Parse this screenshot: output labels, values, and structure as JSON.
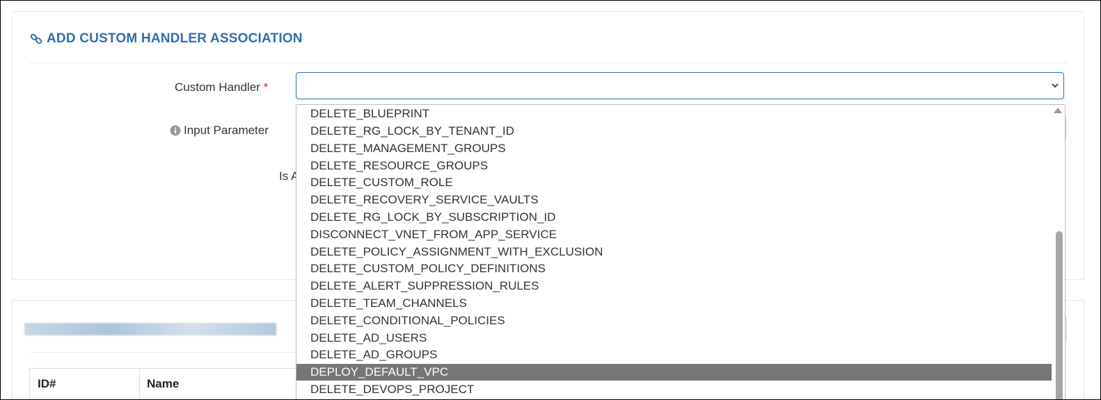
{
  "form": {
    "title": "ADD CUSTOM HANDLER ASSOCIATION",
    "custom_handler_label": "Custom Handler",
    "required_mark": "*",
    "input_parameter_label": "Input Parameter",
    "partial_label": "Is A",
    "custom_handler_value": ""
  },
  "dropdown": {
    "options": [
      "DELETE_BLUEPRINT",
      "DELETE_RG_LOCK_BY_TENANT_ID",
      "DELETE_MANAGEMENT_GROUPS",
      "DELETE_RESOURCE_GROUPS",
      "DELETE_CUSTOM_ROLE",
      "DELETE_RECOVERY_SERVICE_VAULTS",
      "DELETE_RG_LOCK_BY_SUBSCRIPTION_ID",
      "DISCONNECT_VNET_FROM_APP_SERVICE",
      "DELETE_POLICY_ASSIGNMENT_WITH_EXCLUSION",
      "DELETE_CUSTOM_POLICY_DEFINITIONS",
      "DELETE_ALERT_SUPPRESSION_RULES",
      "DELETE_TEAM_CHANNELS",
      "DELETE_CONDITIONAL_POLICIES",
      "DELETE_AD_USERS",
      "DELETE_AD_GROUPS",
      "DEPLOY_DEFAULT_VPC",
      "DELETE_DEVOPS_PROJECT"
    ],
    "highlighted": "DEPLOY_DEFAULT_VPC"
  },
  "table": {
    "headers": [
      "ID#",
      "Name"
    ]
  },
  "icons": {
    "title_icon": "link-icon",
    "info_icon": "info-circle-icon",
    "select_chevron": "chevron-down-icon"
  },
  "colors": {
    "accent": "#2f6fad",
    "required": "#c9302c",
    "highlight": "#767676"
  }
}
